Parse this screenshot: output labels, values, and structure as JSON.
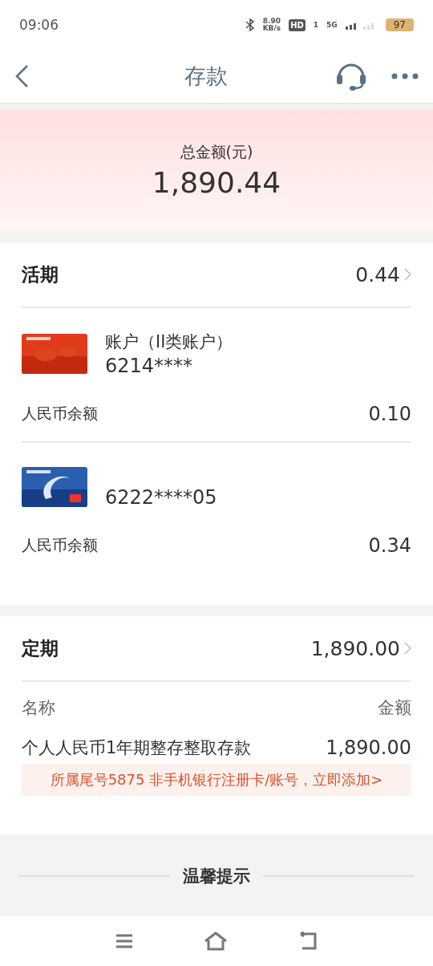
{
  "status_bar": {
    "time": "09:06",
    "speed": "8.90",
    "speed_unit": "KB/s",
    "hd": "HD",
    "sim": "1",
    "network": "5G",
    "battery": "97"
  },
  "header": {
    "title": "存款"
  },
  "total": {
    "label": "总金额(元)",
    "amount": "1,890.44"
  },
  "current": {
    "title": "活期",
    "amount": "0.44",
    "accounts": [
      {
        "kind": "red",
        "name": "账户（II类账户）",
        "number": "6214****",
        "balance_label": "人民币余额",
        "balance": "0.10"
      },
      {
        "kind": "blue",
        "number": "6222****05",
        "balance_label": "人民币余额",
        "balance": "0.34"
      }
    ]
  },
  "fixed": {
    "title": "定期",
    "amount": "1,890.00",
    "col_name": "名称",
    "col_amount": "金额",
    "rows": [
      {
        "name": "个人人民币1年期整存整取存款",
        "amount": "1,890.00"
      }
    ],
    "notice": "所属尾号5875 非手机银行注册卡/账号，立即添加>"
  },
  "tips": {
    "title": "温馨提示"
  }
}
